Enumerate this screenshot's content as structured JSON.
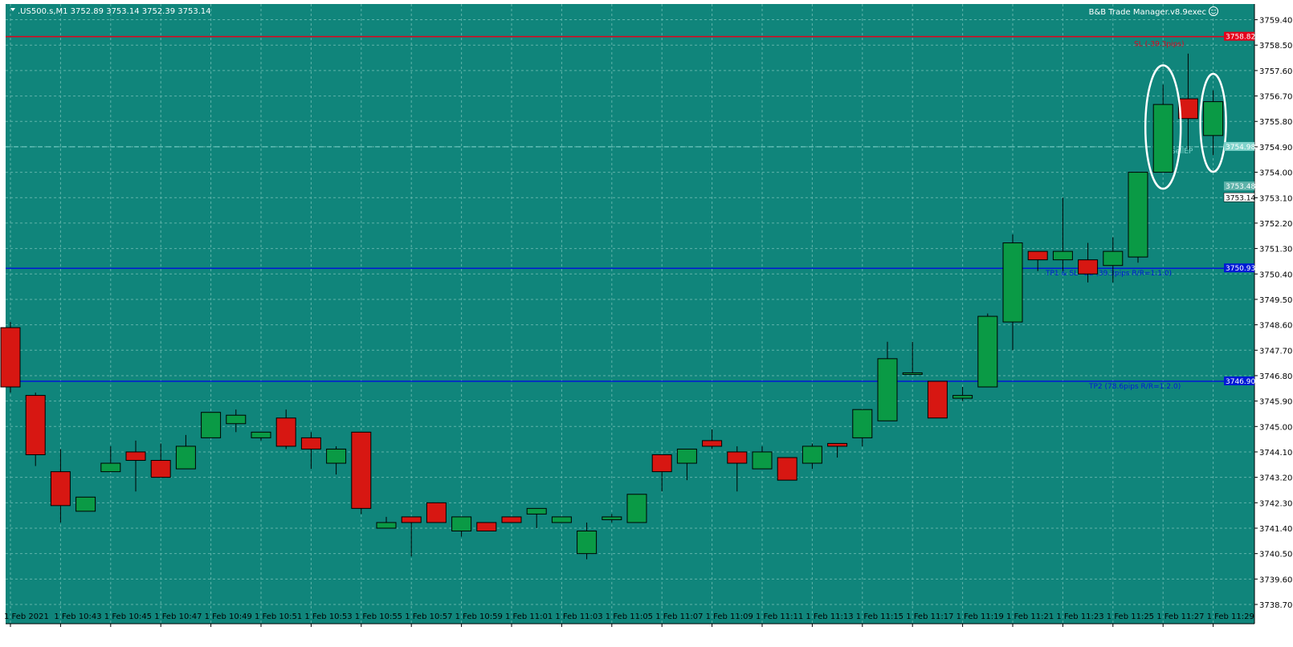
{
  "header": {
    "symbol_line": ".US500.s,M1  3752.89 3753.14 3752.39 3753.14",
    "ea_label": "B&B Trade Manager.v8.9exec",
    "ea_icon": "smiley-icon"
  },
  "colors": {
    "background": "#10857b",
    "frame_bg": "#ffffff",
    "grid": "#5fb3aa",
    "bull": "#0a9a45",
    "bear": "#d71712",
    "candle_outline": "#000000",
    "sl_line": "#e4001b",
    "tp_line": "#0019d6",
    "entry_line": "#7fd3cb",
    "axis_text": "#000000",
    "annotation_circle": "#ffffff"
  },
  "chart_data": {
    "type": "candlestick",
    "symbol": ".US500.s",
    "timeframe": "M1",
    "ylim": [
      3738.7,
      3759.7
    ],
    "y_ticks": [
      "3759.40",
      "3758.50",
      "3757.60",
      "3756.70",
      "3755.80",
      "3754.90",
      "3754.00",
      "3753.10",
      "3752.20",
      "3751.30",
      "3750.40",
      "3749.50",
      "3748.60",
      "3747.70",
      "3746.80",
      "3745.90",
      "3745.00",
      "3744.10",
      "3743.20",
      "3742.30",
      "3741.40",
      "3740.50",
      "3739.60",
      "3738.70"
    ],
    "x_tick_labels": [
      "1 Feb 2021",
      "1 Feb 10:43",
      "1 Feb 10:45",
      "1 Feb 10:47",
      "1 Feb 10:49",
      "1 Feb 10:51",
      "1 Feb 10:53",
      "1 Feb 10:55",
      "1 Feb 10:57",
      "1 Feb 10:59",
      "1 Feb 11:01",
      "1 Feb 11:03",
      "1 Feb 11:05",
      "1 Feb 11:07",
      "1 Feb 11:09",
      "1 Feb 11:11",
      "1 Feb 11:13",
      "1 Feb 11:15",
      "1 Feb 11:17",
      "1 Feb 11:19",
      "1 Feb 11:21",
      "1 Feb 11:23",
      "1 Feb 11:25",
      "1 Feb 11:27",
      "1 Feb 11:29"
    ],
    "candles": [
      {
        "o": 3748.5,
        "h": 3748.7,
        "l": 3746.2,
        "c": 3746.4
      },
      {
        "o": 3746.1,
        "h": 3746.2,
        "l": 3743.6,
        "c": 3744.0
      },
      {
        "o": 3743.4,
        "h": 3744.2,
        "l": 3741.6,
        "c": 3742.2
      },
      {
        "o": 3742.0,
        "h": 3742.5,
        "l": 3742.0,
        "c": 3742.5
      },
      {
        "o": 3743.4,
        "h": 3744.3,
        "l": 3743.4,
        "c": 3743.7
      },
      {
        "o": 3744.1,
        "h": 3744.5,
        "l": 3742.7,
        "c": 3743.8
      },
      {
        "o": 3743.8,
        "h": 3744.4,
        "l": 3743.2,
        "c": 3743.2
      },
      {
        "o": 3743.5,
        "h": 3744.7,
        "l": 3743.5,
        "c": 3744.3
      },
      {
        "o": 3744.6,
        "h": 3745.5,
        "l": 3744.6,
        "c": 3745.5
      },
      {
        "o": 3745.1,
        "h": 3745.6,
        "l": 3744.8,
        "c": 3745.4
      },
      {
        "o": 3744.6,
        "h": 3744.8,
        "l": 3744.5,
        "c": 3744.8
      },
      {
        "o": 3745.3,
        "h": 3745.6,
        "l": 3744.2,
        "c": 3744.3
      },
      {
        "o": 3744.6,
        "h": 3744.8,
        "l": 3743.5,
        "c": 3744.2
      },
      {
        "o": 3743.7,
        "h": 3744.3,
        "l": 3743.3,
        "c": 3744.2
      },
      {
        "o": 3744.8,
        "h": 3744.8,
        "l": 3741.9,
        "c": 3742.1
      },
      {
        "o": 3741.4,
        "h": 3741.8,
        "l": 3741.4,
        "c": 3741.6
      },
      {
        "o": 3741.8,
        "h": 3741.8,
        "l": 3740.4,
        "c": 3741.6
      },
      {
        "o": 3742.3,
        "h": 3742.3,
        "l": 3741.6,
        "c": 3741.6
      },
      {
        "o": 3741.3,
        "h": 3741.8,
        "l": 3741.1,
        "c": 3741.8
      },
      {
        "o": 3741.6,
        "h": 3741.6,
        "l": 3741.3,
        "c": 3741.3
      },
      {
        "o": 3741.8,
        "h": 3741.8,
        "l": 3741.6,
        "c": 3741.6
      },
      {
        "o": 3741.9,
        "h": 3742.1,
        "l": 3741.4,
        "c": 3742.1
      },
      {
        "o": 3741.6,
        "h": 3741.8,
        "l": 3741.6,
        "c": 3741.8
      },
      {
        "o": 3740.5,
        "h": 3741.6,
        "l": 3740.3,
        "c": 3741.3
      },
      {
        "o": 3741.7,
        "h": 3741.9,
        "l": 3741.6,
        "c": 3741.8
      },
      {
        "o": 3741.6,
        "h": 3742.6,
        "l": 3741.6,
        "c": 3742.6
      },
      {
        "o": 3744.0,
        "h": 3744.0,
        "l": 3742.7,
        "c": 3743.4
      },
      {
        "o": 3743.7,
        "h": 3744.2,
        "l": 3743.1,
        "c": 3744.2
      },
      {
        "o": 3744.5,
        "h": 3744.9,
        "l": 3744.2,
        "c": 3744.3
      },
      {
        "o": 3744.1,
        "h": 3744.3,
        "l": 3742.7,
        "c": 3743.7
      },
      {
        "o": 3743.5,
        "h": 3744.3,
        "l": 3743.5,
        "c": 3744.1
      },
      {
        "o": 3743.9,
        "h": 3743.9,
        "l": 3743.1,
        "c": 3743.1
      },
      {
        "o": 3743.7,
        "h": 3744.4,
        "l": 3743.5,
        "c": 3744.3
      },
      {
        "o": 3744.4,
        "h": 3744.4,
        "l": 3743.9,
        "c": 3744.3
      },
      {
        "o": 3744.6,
        "h": 3745.6,
        "l": 3744.3,
        "c": 3745.6
      },
      {
        "o": 3745.2,
        "h": 3748.0,
        "l": 3745.2,
        "c": 3747.4
      },
      {
        "o": 3746.9,
        "h": 3748.0,
        "l": 3746.9,
        "c": 3746.9
      },
      {
        "o": 3746.6,
        "h": 3746.6,
        "l": 3745.3,
        "c": 3745.3
      },
      {
        "o": 3746.0,
        "h": 3746.4,
        "l": 3745.9,
        "c": 3746.1
      },
      {
        "o": 3746.4,
        "h": 3749.0,
        "l": 3746.4,
        "c": 3748.9
      },
      {
        "o": 3748.7,
        "h": 3751.8,
        "l": 3747.7,
        "c": 3751.5
      },
      {
        "o": 3751.2,
        "h": 3751.2,
        "l": 3750.5,
        "c": 3750.9
      },
      {
        "o": 3750.9,
        "h": 3753.1,
        "l": 3750.5,
        "c": 3751.2
      },
      {
        "o": 3750.9,
        "h": 3751.5,
        "l": 3750.1,
        "c": 3750.4
      },
      {
        "o": 3750.7,
        "h": 3751.7,
        "l": 3750.1,
        "c": 3751.2
      },
      {
        "o": 3751.0,
        "h": 3751.0,
        "l": 3750.8,
        "c": 3754.0
      },
      {
        "o": 3754.0,
        "h": 3757.1,
        "l": 3754.0,
        "c": 3756.4
      },
      {
        "o": 3756.6,
        "h": 3758.2,
        "l": 3754.8,
        "c": 3755.9
      },
      {
        "o": 3755.3,
        "h": 3756.9,
        "l": 3754.6,
        "c": 3756.5
      }
    ],
    "levels": [
      {
        "name": "sl",
        "price": 3758.8,
        "price_label": "3758.82",
        "text": "SL (-39.3pips)"
      },
      {
        "name": "tp1",
        "price": 3750.6,
        "price_label": "3750.93",
        "text": "TP1 & SL=BE (39.3pips R/R=1:1.0)"
      },
      {
        "name": "tp2",
        "price": 3746.6,
        "price_label": "3746.90",
        "text": "TP2 (78.6pips R/R=1:2.0)"
      },
      {
        "name": "entry",
        "price": 3754.9,
        "price_label": "3754.98",
        "text": "SellEP"
      }
    ],
    "price_labels_extra": [
      {
        "name": "ask",
        "price": 3753.5,
        "text": "3753.48"
      },
      {
        "name": "current",
        "price": 3753.1,
        "text": "3753.14"
      }
    ],
    "annotations": [
      "circle around candle 47",
      "circle around candle 49"
    ]
  }
}
